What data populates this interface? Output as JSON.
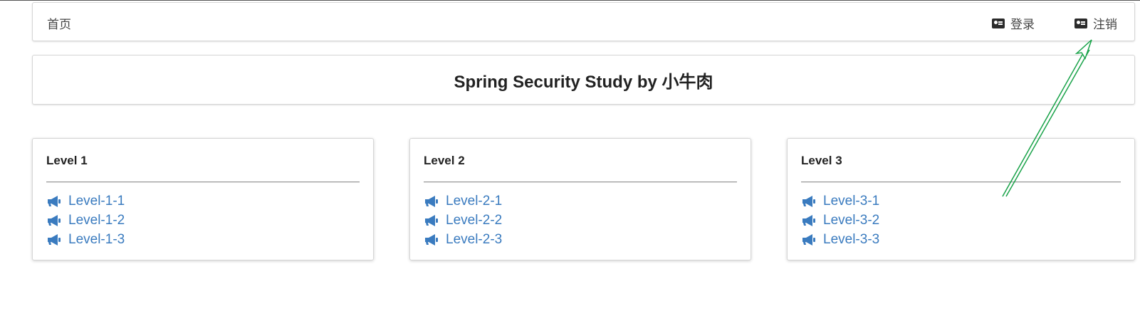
{
  "menu": {
    "home_label": "首页",
    "login_label": "登录",
    "logout_label": "注销"
  },
  "page_title": "Spring Security Study by 小牛肉",
  "cards": [
    {
      "title": "Level 1",
      "links": [
        "Level-1-1",
        "Level-1-2",
        "Level-1-3"
      ]
    },
    {
      "title": "Level 2",
      "links": [
        "Level-2-1",
        "Level-2-2",
        "Level-2-3"
      ]
    },
    {
      "title": "Level 3",
      "links": [
        "Level-3-1",
        "Level-3-2",
        "Level-3-3"
      ]
    }
  ],
  "icons": {
    "nav_icon": "id-card-icon",
    "link_icon": "bullhorn-icon"
  },
  "colors": {
    "link": "#3a7bbf",
    "annotation_arrow": "#1aa34a"
  }
}
